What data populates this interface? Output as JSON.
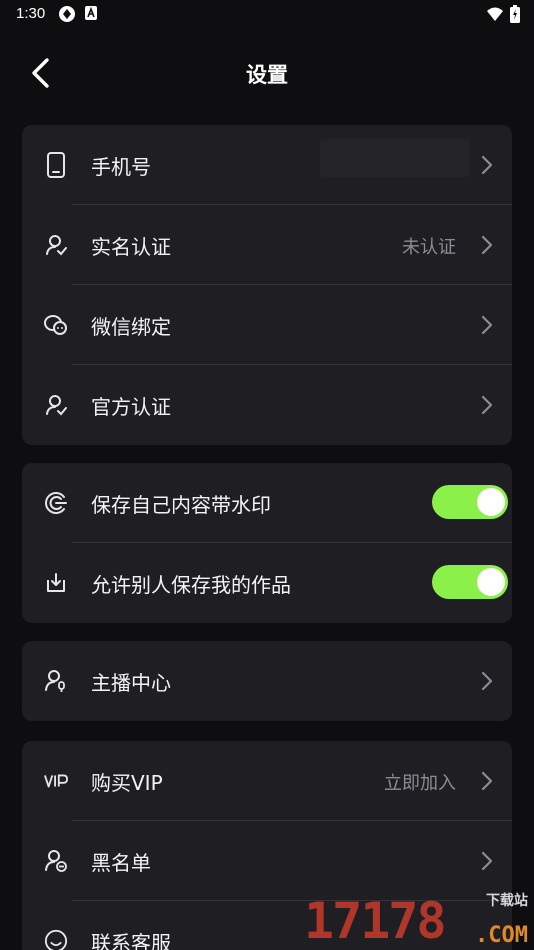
{
  "status_bar": {
    "time": "1:30"
  },
  "header": {
    "title": "设置"
  },
  "group1": {
    "phone_label": "手机号",
    "realname_label": "实名认证",
    "realname_value": "未认证",
    "wechat_label": "微信绑定",
    "official_label": "官方认证"
  },
  "group2": {
    "watermark_label": "保存自己内容带水印",
    "watermark_on": true,
    "allow_save_label": "允许别人保存我的作品",
    "allow_save_on": true
  },
  "group3": {
    "anchor_label": "主播中心"
  },
  "group4": {
    "vip_label": "购买VIP",
    "vip_value": "立即加入",
    "blacklist_label": "黑名单",
    "service_label": "联系客服"
  },
  "watermark": {
    "digits": "17178",
    "site": "下载站",
    "com": ".COM"
  },
  "colors": {
    "background": "#0e0e10",
    "card": "#1f1f23",
    "toggle_on": "#8bf04a",
    "value_text": "#8c8c92"
  }
}
